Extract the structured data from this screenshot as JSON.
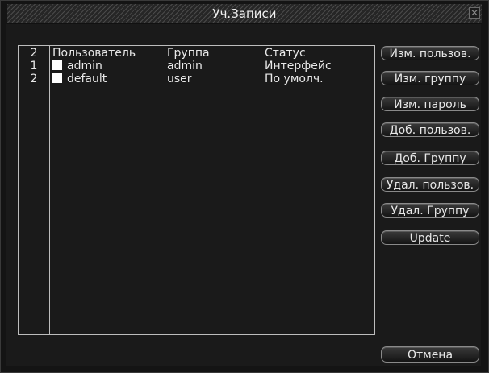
{
  "window": {
    "title": "Уч.Записи",
    "close_glyph": "✕"
  },
  "table": {
    "count": "2",
    "columns": {
      "user": "Пользователь",
      "group": "Группа",
      "status": "Статус"
    },
    "rows": [
      {
        "num": "1",
        "user": "admin",
        "group": "admin",
        "status": "Интерфейс",
        "checked": false
      },
      {
        "num": "2",
        "user": "default",
        "group": "user",
        "status": "По умолч.",
        "checked": false
      }
    ]
  },
  "buttons": {
    "edit_user": "Изм. пользов.",
    "edit_group": "Изм. группу",
    "edit_password": "Изм. пароль",
    "add_user": "Доб. пользов.",
    "add_group": "Доб. Группу",
    "delete_user": "Удал. пользов.",
    "delete_group": "Удал. Группу",
    "update": "Update",
    "cancel": "Отмена"
  },
  "colors": {
    "background": "#141414",
    "text": "#e8e8e8",
    "border": "#bdbdbd"
  }
}
